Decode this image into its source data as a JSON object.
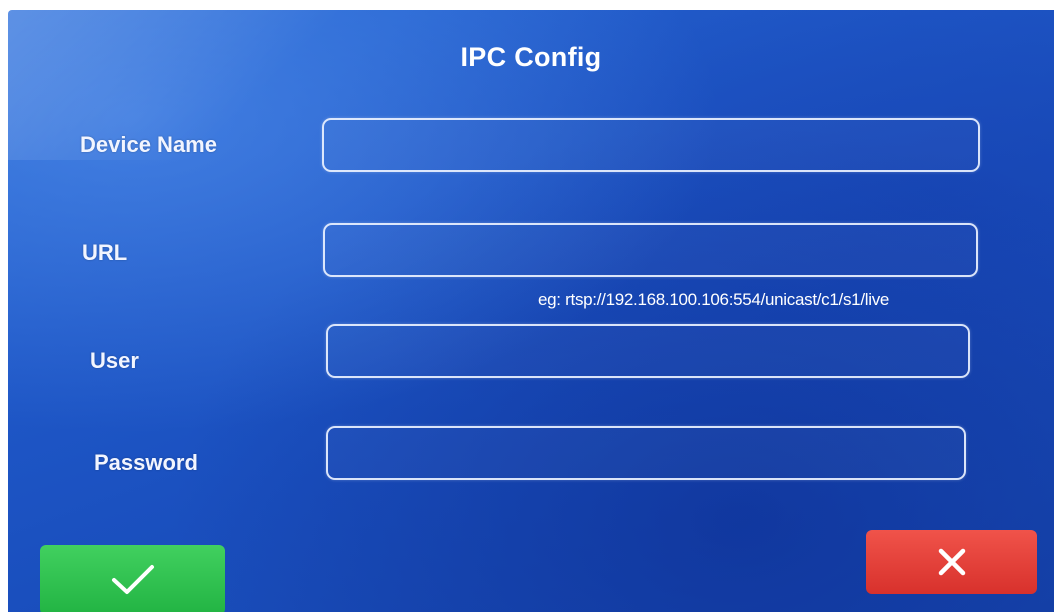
{
  "dialog": {
    "title": "IPC Config"
  },
  "fields": {
    "device_name": {
      "label": "Device Name",
      "value": ""
    },
    "url": {
      "label": "URL",
      "value": "",
      "hint": "eg:  rtsp://192.168.100.106:554/unicast/c1/s1/live"
    },
    "user": {
      "label": "User",
      "value": ""
    },
    "password": {
      "label": "Password",
      "value": ""
    }
  },
  "actions": {
    "confirm_icon": "checkmark-icon",
    "cancel_icon": "close-icon"
  },
  "colors": {
    "background": "#1f58c8",
    "confirm": "#2cc04c",
    "cancel": "#e8423c",
    "text": "#ffffff"
  }
}
